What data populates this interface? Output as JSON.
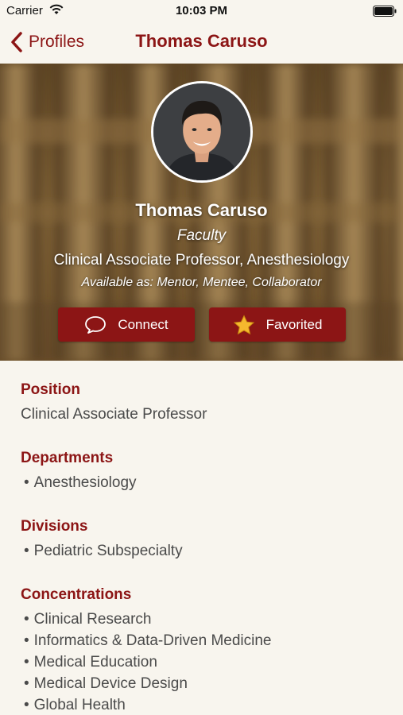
{
  "status_bar": {
    "carrier": "Carrier",
    "time": "10:03 PM"
  },
  "nav": {
    "back_label": "Profiles",
    "title": "Thomas Caruso"
  },
  "profile": {
    "name": "Thomas Caruso",
    "role": "Faculty",
    "title": "Clinical Associate Professor, Anesthesiology",
    "available_as": "Available as: Mentor, Mentee, Collaborator"
  },
  "actions": {
    "connect_label": "Connect",
    "favorited_label": "Favorited"
  },
  "sections": {
    "position": {
      "heading": "Position",
      "value": "Clinical Associate Professor"
    },
    "departments": {
      "heading": "Departments",
      "items": [
        "Anesthesiology"
      ]
    },
    "divisions": {
      "heading": "Divisions",
      "items": [
        "Pediatric Subspecialty"
      ]
    },
    "concentrations": {
      "heading": "Concentrations",
      "items": [
        "Clinical Research",
        "Informatics & Data-Driven Medicine",
        "Medical Education",
        "Medical Device Design",
        "Global Health"
      ]
    }
  },
  "colors": {
    "brand": "#8c1515",
    "background": "#f8f5ee",
    "star": "#f5b82e"
  },
  "icons": [
    "wifi-icon",
    "battery-icon",
    "back-chevron-icon",
    "chat-bubble-icon",
    "star-icon"
  ]
}
